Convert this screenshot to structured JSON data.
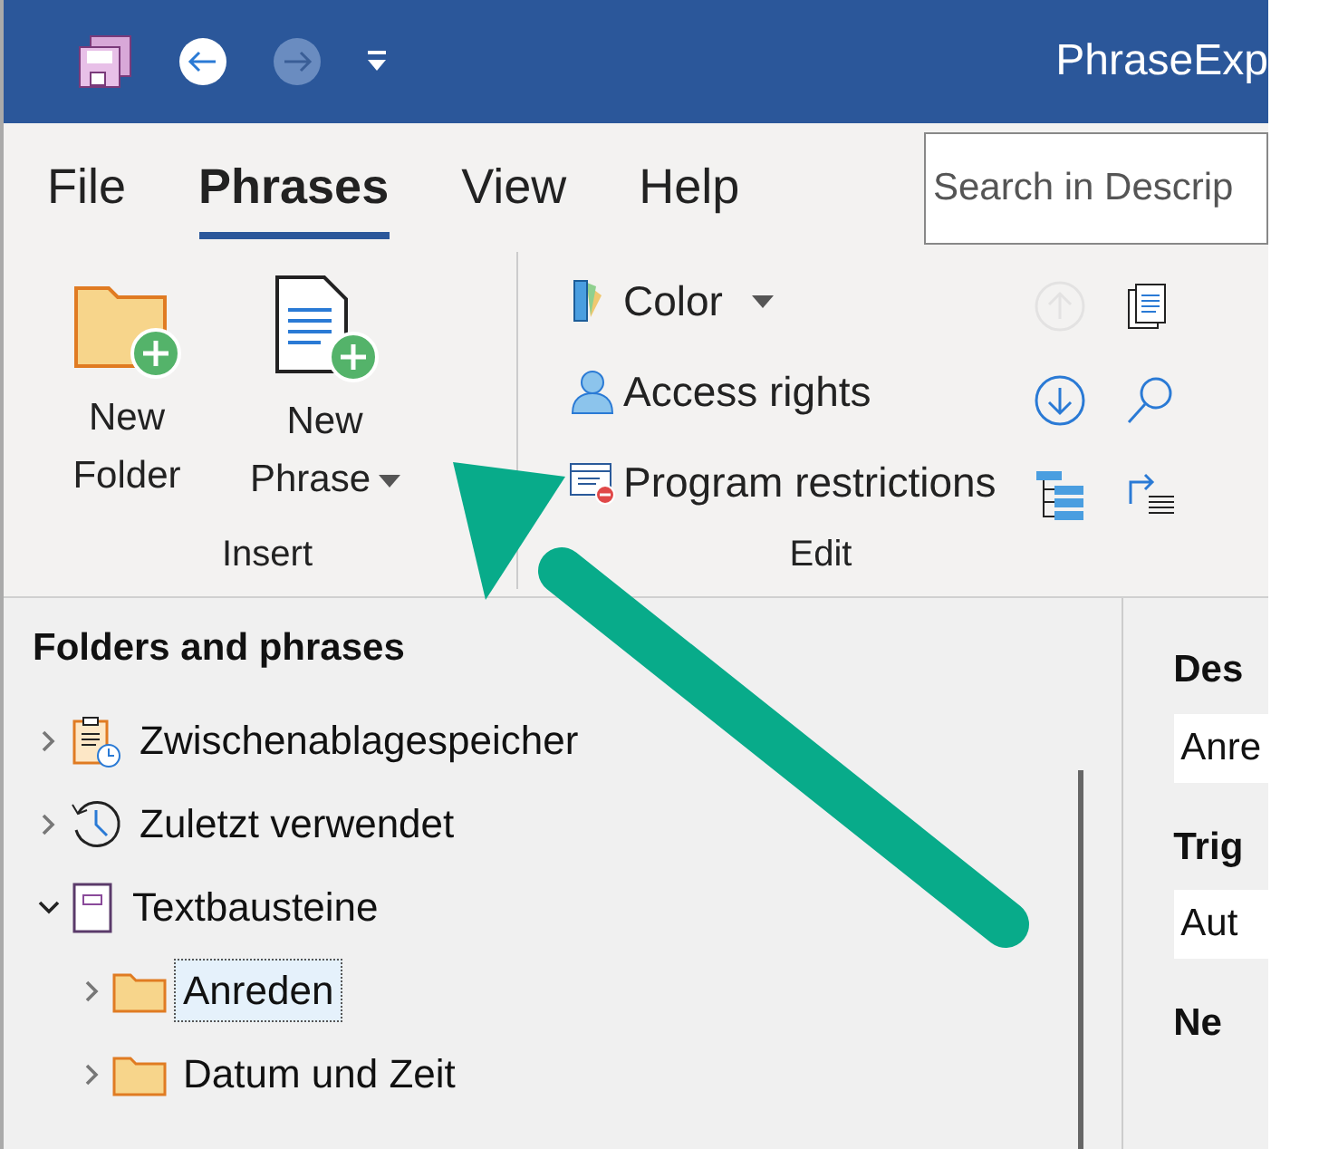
{
  "window": {
    "title": "PhraseExp"
  },
  "tabs": [
    {
      "label": "File",
      "selected": false
    },
    {
      "label": "Phrases",
      "selected": true
    },
    {
      "label": "View",
      "selected": false
    },
    {
      "label": "Help",
      "selected": false
    }
  ],
  "search": {
    "placeholder": "Search in Descrip"
  },
  "ribbon": {
    "insert": {
      "label": "Insert",
      "buttons": [
        {
          "kind": "folder",
          "lines": [
            "New",
            "Folder"
          ],
          "dropdown": false
        },
        {
          "kind": "phrase",
          "lines": [
            "New",
            "Phrase"
          ],
          "dropdown": true
        }
      ]
    },
    "edit": {
      "label": "Edit",
      "buttons": [
        {
          "kind": "color",
          "label": "Color",
          "dropdown": true
        },
        {
          "kind": "access",
          "label": "Access rights",
          "dropdown": false
        },
        {
          "kind": "restrict",
          "label": "Program restrictions",
          "dropdown": false
        }
      ],
      "small_buttons": [
        {
          "kind": "up",
          "disabled": true
        },
        {
          "kind": "copy",
          "disabled": false
        },
        {
          "kind": "down",
          "disabled": false
        },
        {
          "kind": "search",
          "disabled": false
        },
        {
          "kind": "tree",
          "disabled": false
        },
        {
          "kind": "move",
          "disabled": false
        }
      ]
    }
  },
  "tree": {
    "title": "Folders and phrases",
    "items": [
      {
        "label": "Zwischenablagespeicher",
        "kind": "clipboard",
        "expanded": false,
        "selected": false
      },
      {
        "label": "Zuletzt verwendet",
        "kind": "clock",
        "expanded": false,
        "selected": false
      },
      {
        "label": "Textbausteine",
        "kind": "book",
        "expanded": true,
        "selected": false,
        "children": [
          {
            "label": "Anreden",
            "kind": "folder",
            "expanded": false,
            "selected": true
          },
          {
            "label": "Datum und Zeit",
            "kind": "folder",
            "expanded": false,
            "selected": false
          }
        ]
      }
    ]
  },
  "details": [
    {
      "kind": "label",
      "text": "Des"
    },
    {
      "kind": "field",
      "text": "Anre"
    },
    {
      "kind": "label",
      "text": "Trig"
    },
    {
      "kind": "field",
      "text": "Aut"
    },
    {
      "kind": "label",
      "text": "Ne"
    }
  ]
}
